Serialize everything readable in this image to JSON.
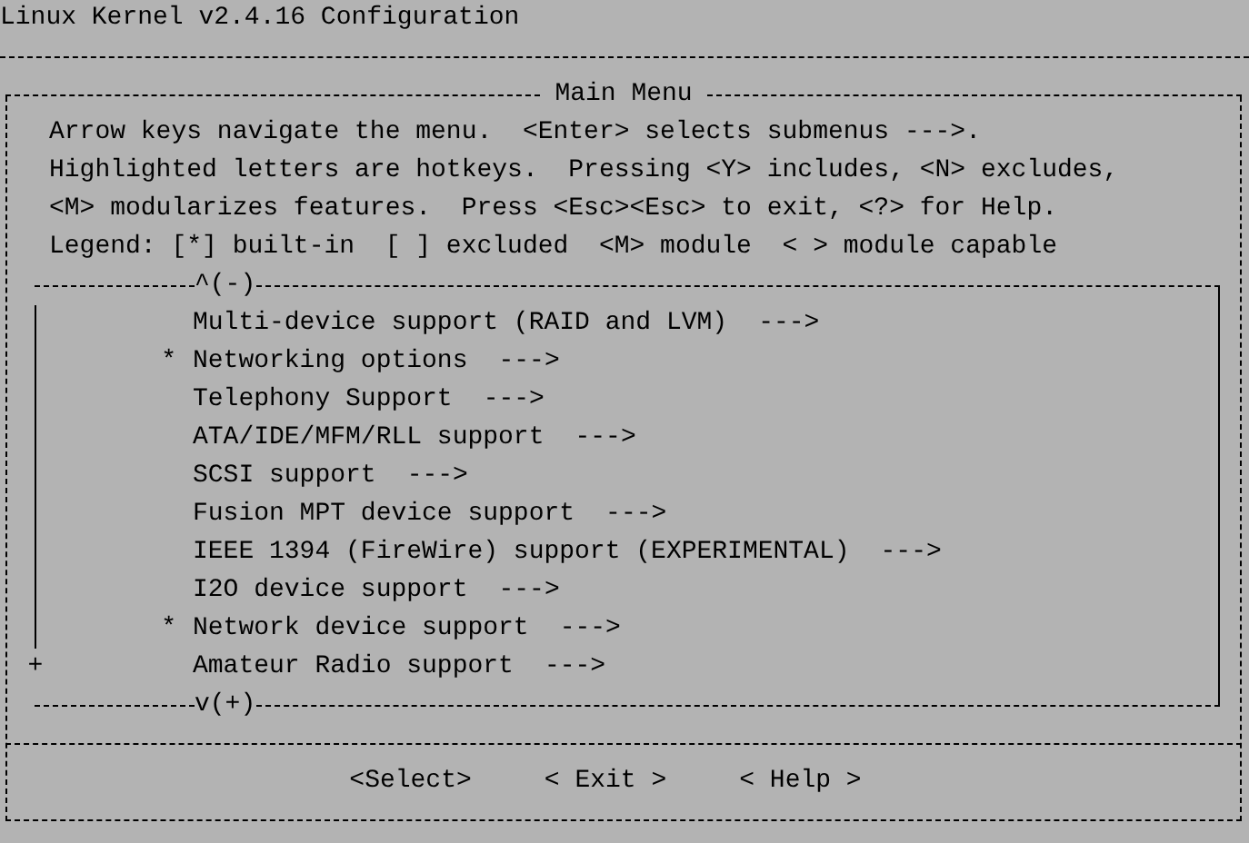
{
  "window": {
    "title": "Linux Kernel v2.4.16 Configuration"
  },
  "menu": {
    "title": "Main Menu",
    "instructions": [
      "Arrow keys navigate the menu.  <Enter> selects submenus --->.",
      "Highlighted letters are hotkeys.  Pressing <Y> includes, <N> excludes,",
      "<M> modularizes features.  Press <Esc><Esc> to exit, <?> for Help.",
      "Legend: [*] built-in  [ ] excluded  <M> module  < > module capable"
    ],
    "scroll_up": "^(-)",
    "items": [
      {
        "label": "Multi-device support (RAID and LVM)",
        "arrow": "--->"
      },
      {
        "prefix": "*",
        "label": "Networking options",
        "arrow": "--->"
      },
      {
        "label": "Telephony Support",
        "arrow": "--->"
      },
      {
        "label": "ATA/IDE/MFM/RLL support",
        "arrow": "--->"
      },
      {
        "label": "SCSI support",
        "arrow": "--->"
      },
      {
        "label": "Fusion MPT device support",
        "arrow": "--->"
      },
      {
        "label": "IEEE 1394 (FireWire) support (EXPERIMENTAL)",
        "arrow": "--->"
      },
      {
        "label": "I2O device support",
        "arrow": "--->"
      },
      {
        "prefix": "*",
        "label": "Network device support",
        "arrow": "--->"
      },
      {
        "more_marker": "+",
        "label": "Amateur Radio support",
        "arrow": "--->"
      }
    ],
    "scroll_down": "v(+)",
    "buttons": [
      "<Select>",
      "< Exit >",
      "< Help >"
    ]
  }
}
